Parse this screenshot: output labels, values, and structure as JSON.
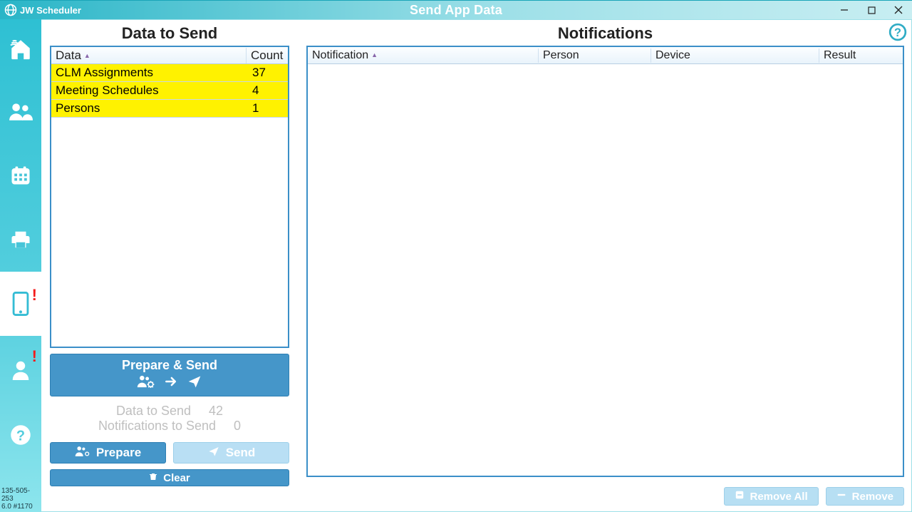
{
  "app_name": "JW Scheduler",
  "window_title": "Send App Data",
  "status_line1": "135-505-253",
  "status_line2": "6.0 #1170",
  "left_panel": {
    "heading": "Data to Send",
    "columns": {
      "data": "Data",
      "count": "Count"
    },
    "rows": [
      {
        "label": "CLM Assignments",
        "count": "37"
      },
      {
        "label": "Meeting Schedules",
        "count": "4"
      },
      {
        "label": "Persons",
        "count": "1"
      }
    ],
    "prepare_send": "Prepare & Send",
    "summary_data_label": "Data to Send",
    "summary_data_value": "42",
    "summary_notif_label": "Notifications to Send",
    "summary_notif_value": "0",
    "btn_prepare": "Prepare",
    "btn_send": "Send",
    "btn_clear": "Clear"
  },
  "right_panel": {
    "heading": "Notifications",
    "columns": {
      "notification": "Notification",
      "person": "Person",
      "device": "Device",
      "result": "Result"
    },
    "btn_remove_all": "Remove All",
    "btn_remove": "Remove"
  }
}
